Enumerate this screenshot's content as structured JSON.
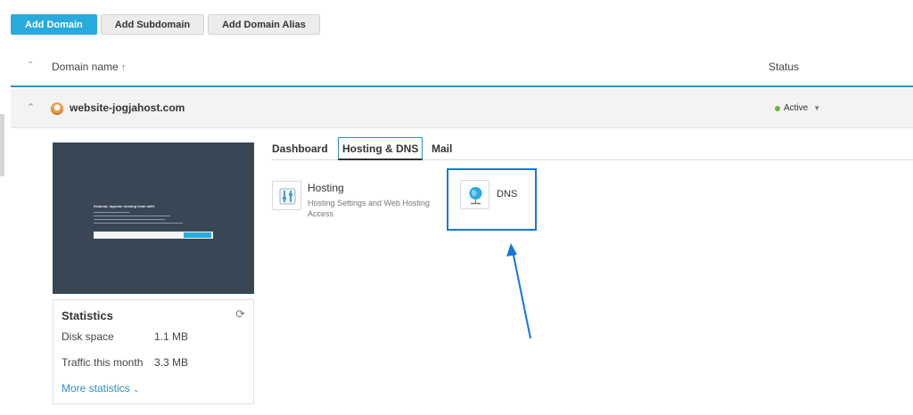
{
  "toolbar": {
    "add_domain": "Add Domain",
    "add_subdomain": "Add Subdomain",
    "add_domain_alias": "Add Domain Alias"
  },
  "list": {
    "col_domain": "Domain name",
    "col_status": "Status"
  },
  "domain": {
    "name": "website-jogjahost.com",
    "status": "Active"
  },
  "preview": {
    "title": "Selamat, layanan hosting telah aktif."
  },
  "stats": {
    "title": "Statistics",
    "disk_label": "Disk space",
    "disk_value": "1.1 MB",
    "traffic_label": "Traffic this month",
    "traffic_value": "3.3 MB",
    "more": "More statistics"
  },
  "tabs": {
    "dashboard": "Dashboard",
    "hosting_dns": "Hosting & DNS",
    "mail": "Mail"
  },
  "cards": {
    "hosting_title": "Hosting",
    "hosting_desc": "Hosting Settings and Web Hosting Access",
    "dns_title": "DNS"
  },
  "colors": {
    "primary": "#28aadc",
    "link": "#2d8fc9",
    "highlight": "#1478dc",
    "active": "#6fb53f"
  }
}
